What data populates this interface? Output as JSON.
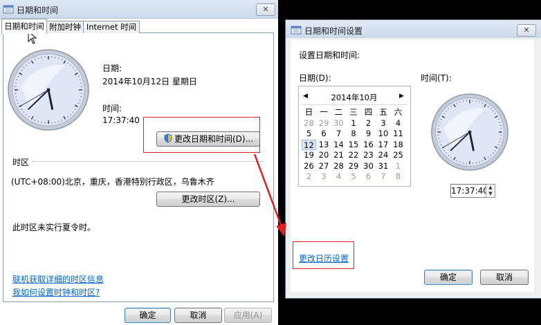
{
  "left": {
    "title": "日期和时间",
    "close": "✕",
    "tabs": [
      "日期和时间",
      "附加时钟",
      "Internet 时间"
    ],
    "date_label": "日期:",
    "date_value": "2014年10月12日 星期日",
    "time_label": "时间:",
    "time_value": "17:37:40",
    "change_datetime_button": "更改日期和时间(D)...",
    "timezone_section": "时区",
    "timezone_value": "(UTC+08:00)北京，重庆，香港特别行政区，乌鲁木齐",
    "change_timezone_button": "更改时区(Z)...",
    "dst_note": "此时区未实行夏令时。",
    "link_online_info": "联机获取详细的时区信息",
    "link_how_to_set": "我如何设置时钟和时区?",
    "ok": "确定",
    "cancel": "取消",
    "apply": "应用(A)"
  },
  "right": {
    "title": "日期和时间设置",
    "close": "✕",
    "heading": "设置日期和时间:",
    "date_label": "日期(D):",
    "time_label": "时间(T):",
    "month_label": "2014年10月",
    "prev": "◀",
    "next": "▶",
    "weekdays": [
      "日",
      "一",
      "二",
      "三",
      "四",
      "五",
      "六"
    ],
    "days": [
      [
        "28",
        "29",
        "30",
        "1",
        "2",
        "3",
        "4"
      ],
      [
        "5",
        "6",
        "7",
        "8",
        "9",
        "10",
        "11"
      ],
      [
        "12",
        "13",
        "14",
        "15",
        "16",
        "17",
        "18"
      ],
      [
        "19",
        "20",
        "21",
        "22",
        "23",
        "24",
        "25"
      ],
      [
        "26",
        "27",
        "28",
        "29",
        "30",
        "31",
        "1"
      ],
      [
        "2",
        "3",
        "4",
        "5",
        "6",
        "7",
        "8"
      ]
    ],
    "time_value": "17:37:40",
    "spin_up": "▲",
    "spin_down": "▼",
    "change_calendar_link": "更改日历设置",
    "ok": "确定",
    "cancel": "取消"
  },
  "clock_time": {
    "hour": 17,
    "minute": 37,
    "second": 40
  },
  "colors": {
    "annotation_red": "#e02020",
    "link_blue": "#0066cc",
    "clock_face": "#dfe6f6"
  },
  "icons": {
    "title": "calendar-clock-icon",
    "shield": "uac-shield-icon",
    "cursor": "mouse-pointer-icon",
    "arrow": "red-annotation-arrow"
  }
}
